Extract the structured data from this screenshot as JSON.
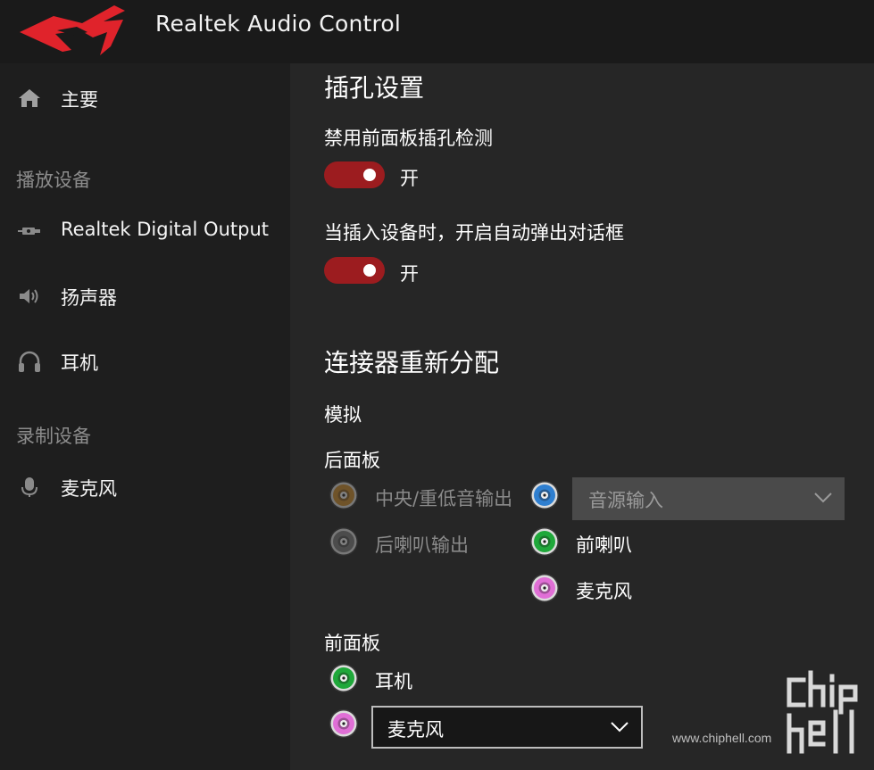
{
  "app": {
    "title": "Realtek Audio Control"
  },
  "sidebar": {
    "home": {
      "label": "主要",
      "icon": "home-icon"
    },
    "playback_section": "播放设备",
    "playback_items": [
      {
        "label": "Realtek Digital Output",
        "icon": "digital-output-icon"
      },
      {
        "label": "扬声器",
        "icon": "speaker-icon"
      },
      {
        "label": "耳机",
        "icon": "headphones-icon"
      }
    ],
    "recording_section": "录制设备",
    "recording_items": [
      {
        "label": "麦克风",
        "icon": "microphone-icon"
      }
    ]
  },
  "main": {
    "jack_settings_title": "插孔设置",
    "disable_front_detect": {
      "label": "禁用前面板插孔检测",
      "state": "开",
      "on": true
    },
    "auto_popup": {
      "label": "当插入设备时，开启自动弹出对话框",
      "state": "开",
      "on": true
    },
    "connector_title": "连接器重新分配",
    "analog_label": "模拟",
    "rear_panel": {
      "label": "后面板",
      "jacks": [
        {
          "label": "中央/重低音输出",
          "color": "#c98a2e",
          "enabled": false
        },
        {
          "label": "后喇叭输出",
          "color": "#7a7a7a",
          "enabled": false
        },
        {
          "label": "",
          "color": "#2f7fd0",
          "enabled": true
        },
        {
          "label": "前喇叭",
          "color": "#1fa83a",
          "enabled": true
        },
        {
          "label": "麦克风",
          "color": "#e06fd6",
          "enabled": true
        }
      ],
      "blue_jack_select": {
        "value": "音源输入",
        "enabled": false
      }
    },
    "front_panel": {
      "label": "前面板",
      "jacks": [
        {
          "label": "耳机",
          "color": "#1fa83a"
        },
        {
          "label": "",
          "color": "#e06fd6"
        }
      ],
      "pink_jack_select": {
        "value": "麦克风",
        "enabled": true
      }
    }
  },
  "watermark": {
    "text": "www.chiphell.com",
    "logo_text": "chiphell"
  },
  "colors": {
    "accent": "#9c1c1f",
    "sidebar": "#1e1e1e",
    "titlebar": "#1a1a1a",
    "background": "#262626"
  }
}
